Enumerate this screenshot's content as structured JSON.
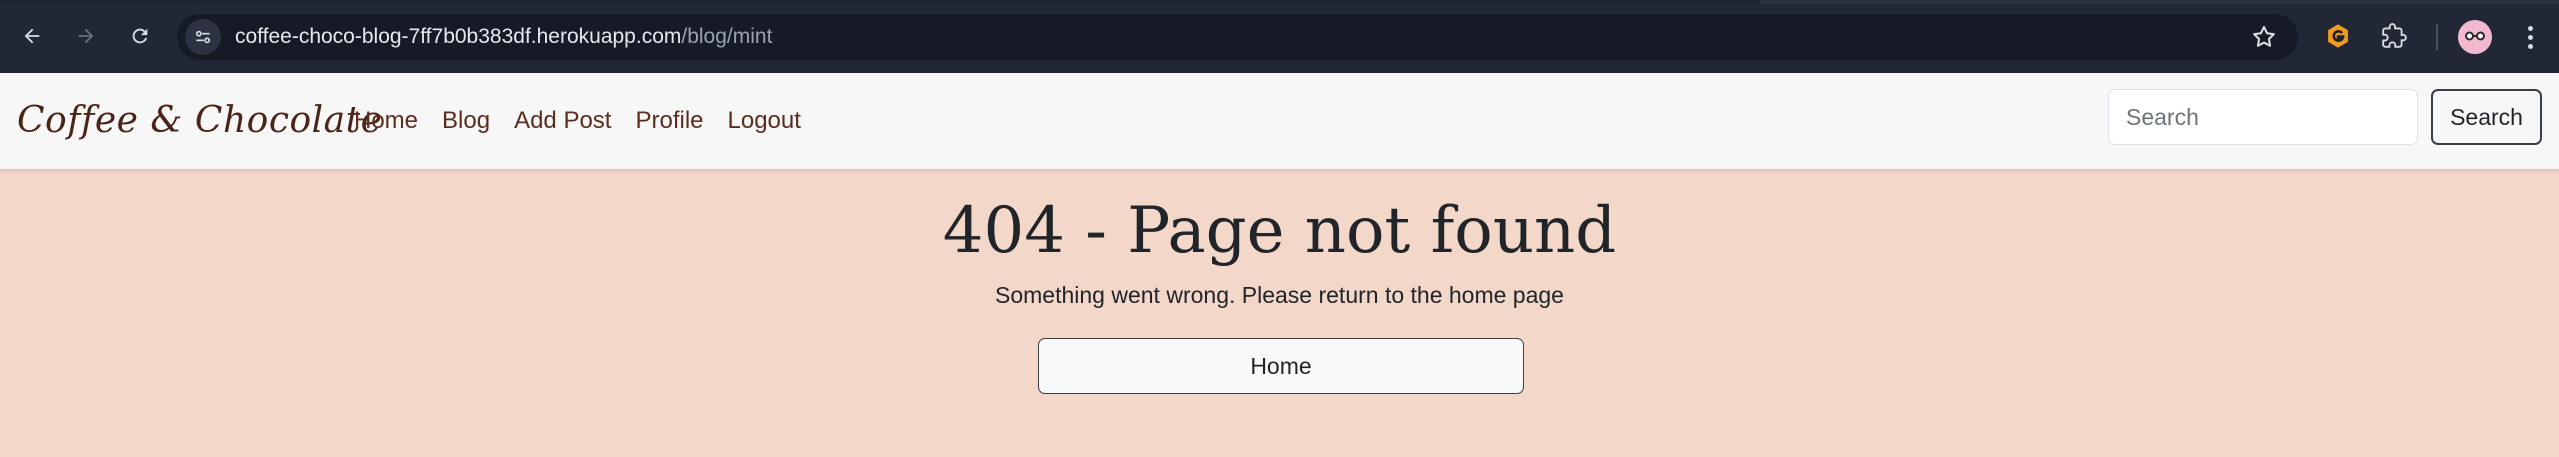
{
  "browser": {
    "url_host": "coffee-choco-blog-7ff7b0b383df.herokuapp.com",
    "url_path": "/blog/mint",
    "icons": [
      "back-icon",
      "forward-icon",
      "reload-icon",
      "site-info-icon",
      "bookmark-star-icon",
      "extension-g-icon",
      "extensions-puzzle-icon",
      "profile-avatar",
      "menu-dots-icon"
    ]
  },
  "navbar": {
    "brand": "Coffee & Chocolate",
    "links": [
      "Home",
      "Blog",
      "Add Post",
      "Profile",
      "Logout"
    ],
    "search_placeholder": "Search",
    "search_button": "Search"
  },
  "main": {
    "title": "404 - Page not found",
    "message": "Something went wrong. Please return to the home page",
    "home_button": "Home"
  },
  "colors": {
    "page_background": "#f3d8ca",
    "navbar_background": "#f7f7f7",
    "nav_link": "#5a2d1f",
    "brand": "#4a2419",
    "chrome": "#222736"
  }
}
